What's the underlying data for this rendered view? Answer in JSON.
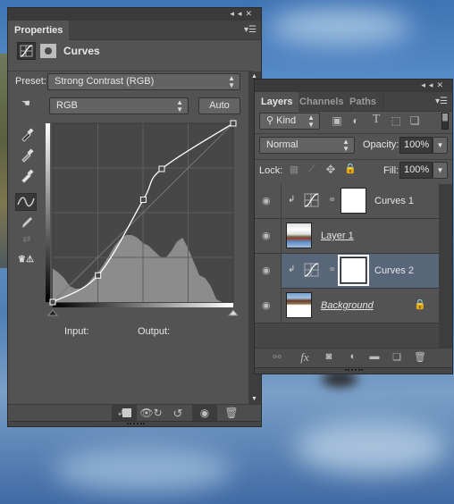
{
  "properties_panel": {
    "tab_label": "Properties",
    "panel_type": "Curves",
    "icons": [
      "adjustment-curves-icon",
      "mask-icon"
    ],
    "preset_label": "Preset:",
    "preset_value": "Strong Contrast (RGB)",
    "channel_value": "RGB",
    "auto_label": "Auto",
    "input_label": "Input:",
    "output_label": "Output:",
    "tools": [
      "targeted-adjustment-hand-icon",
      "black-point-eyedropper-icon",
      "gray-point-eyedropper-icon",
      "white-point-eyedropper-icon",
      "curve-points-icon",
      "pencil-icon",
      "smooth-icon",
      "clipping-warning-icon"
    ],
    "footer_buttons": [
      "clip-to-layer",
      "view-previous-state",
      "reset",
      "toggle-visibility",
      "delete"
    ]
  },
  "curve": {
    "points": [
      [
        0,
        0
      ],
      [
        64,
        38
      ],
      [
        128,
        146
      ],
      [
        154,
        190
      ],
      [
        255,
        255
      ]
    ],
    "input_range": [
      0,
      255
    ],
    "output_range": [
      0,
      255
    ]
  },
  "layers_panel": {
    "tabs": [
      {
        "label": "Layers",
        "active": true
      },
      {
        "label": "Channels",
        "active": false
      },
      {
        "label": "Paths",
        "active": false
      }
    ],
    "filter_kind": "Kind",
    "blend_mode": "Normal",
    "opacity_label": "Opacity:",
    "opacity_value": "100%",
    "lock_label": "Lock:",
    "fill_label": "Fill:",
    "fill_value": "100%",
    "layers": [
      {
        "name": "Curves 1",
        "type": "adjustment",
        "clipped": true,
        "selected": false,
        "visible": true
      },
      {
        "name": "Layer 1",
        "type": "pixel",
        "clipped": false,
        "selected": false,
        "visible": true
      },
      {
        "name": "Curves 2",
        "type": "adjustment",
        "clipped": true,
        "selected": true,
        "visible": true
      },
      {
        "name": "Background",
        "type": "background",
        "clipped": false,
        "selected": false,
        "visible": true,
        "locked": true
      }
    ],
    "footer_buttons": [
      "link-layers",
      "add-layer-style",
      "add-layer-mask",
      "new-fill-adjustment-layer",
      "new-group",
      "new-layer",
      "delete-layer"
    ]
  }
}
